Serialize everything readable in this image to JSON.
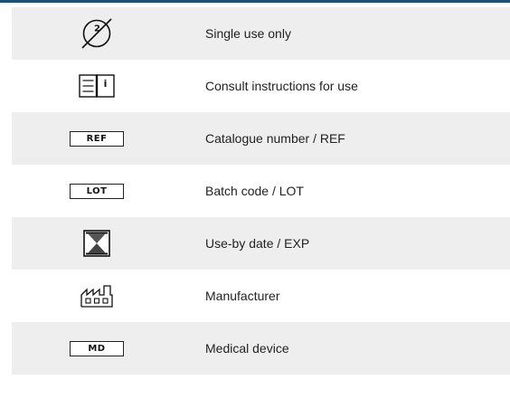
{
  "symbols": [
    {
      "icon": "do-not-reuse-icon",
      "label": "Single use only",
      "code": "",
      "glyph": "2"
    },
    {
      "icon": "instructions-icon",
      "label": "Consult instructions for use",
      "code": "",
      "glyph": "i"
    },
    {
      "icon": "ref-icon",
      "label": "Catalogue number / REF",
      "code": "REF",
      "glyph": ""
    },
    {
      "icon": "lot-icon",
      "label": "Batch code / LOT",
      "code": "LOT",
      "glyph": ""
    },
    {
      "icon": "hourglass-icon",
      "label": "Use-by date / EXP",
      "code": "",
      "glyph": ""
    },
    {
      "icon": "manufacturer-icon",
      "label": "Manufacturer",
      "code": "",
      "glyph": ""
    },
    {
      "icon": "md-icon",
      "label": "Medical device",
      "code": "MD",
      "glyph": ""
    }
  ],
  "colors": {
    "accent_rule": "#1f4f73",
    "row_shade": "#eeeeee",
    "text": "#222222"
  }
}
